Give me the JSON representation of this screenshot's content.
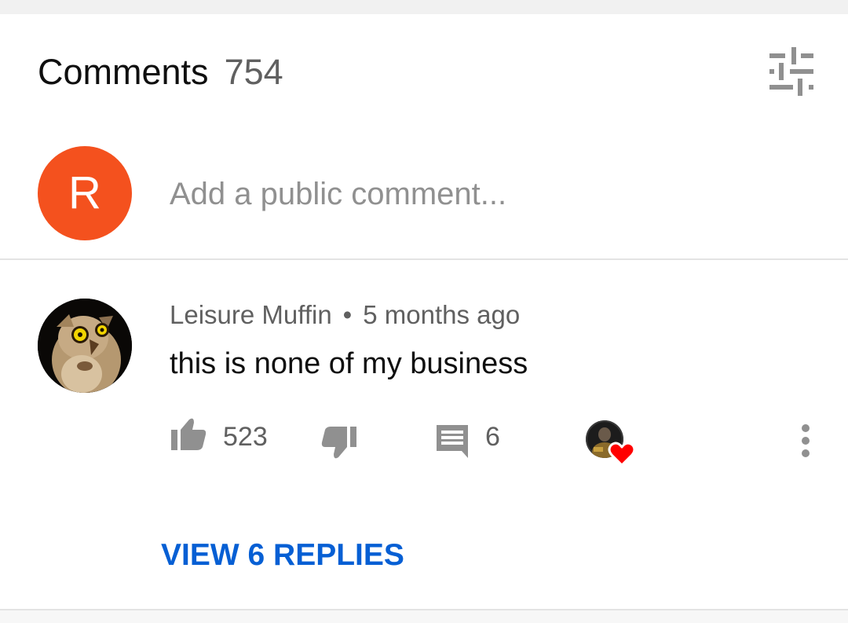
{
  "header": {
    "title": "Comments",
    "count": "754",
    "filter_icon": "sort-sliders-icon"
  },
  "composer": {
    "avatar_letter": "R",
    "avatar_color": "#f4511e",
    "placeholder": "Add a public comment..."
  },
  "comment": {
    "author": "Leisure Muffin",
    "separator": "•",
    "time": "5 months ago",
    "text": "this is none of my business",
    "likes": "523",
    "replies": "6",
    "hearted_by_creator": true,
    "view_replies_label": "VIEW 6 REPLIES"
  },
  "colors": {
    "link": "#065fd4",
    "heart": "#ff0000",
    "secondary_text": "#606060",
    "primary_text": "#0f0f0f"
  },
  "icons": {
    "like": "thumbs-up-icon",
    "dislike": "thumbs-down-icon",
    "reply": "comment-icon",
    "heart": "heart-icon",
    "more": "more-vertical-icon"
  }
}
